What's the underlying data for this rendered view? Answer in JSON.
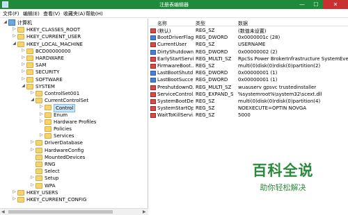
{
  "window": {
    "title": "注册表编辑器",
    "min": "—",
    "max": "☐",
    "close": "✕"
  },
  "menu": [
    "文件(F)",
    "编辑(E)",
    "查看(V)",
    "收藏夹(A)",
    "帮助(H)"
  ],
  "tree": [
    {
      "label": "计算机",
      "arrow": "◢",
      "icon": "pc"
    },
    {
      "label": "HKEY_CLASSES_ROOT",
      "arrow": "▷"
    },
    {
      "label": "HKEY_CURRENT_USER",
      "arrow": "▷"
    },
    {
      "label": "HKEY_LOCAL_MACHINE",
      "arrow": "◢"
    },
    {
      "label": "BCD00000000",
      "arrow": "▷"
    },
    {
      "label": "HARDWARE",
      "arrow": "▷"
    },
    {
      "label": "SAM",
      "arrow": "▷"
    },
    {
      "label": "SECURITY",
      "arrow": "▷"
    },
    {
      "label": "SOFTWARE",
      "arrow": "▷"
    },
    {
      "label": "SYSTEM",
      "arrow": "◢"
    },
    {
      "label": "ControlSet001",
      "arrow": "▷"
    },
    {
      "label": "CurrentControlSet",
      "arrow": "◢"
    },
    {
      "label": "Control",
      "arrow": "▷",
      "selected": true
    },
    {
      "label": "Enum",
      "arrow": "▷"
    },
    {
      "label": "Hardware Profiles",
      "arrow": "▷"
    },
    {
      "label": "Policies",
      "arrow": ""
    },
    {
      "label": "Services",
      "arrow": "▷"
    },
    {
      "label": "DriverDatabase",
      "arrow": "▷"
    },
    {
      "label": "HardwareConfig",
      "arrow": "▷"
    },
    {
      "label": "MountedDevices",
      "arrow": ""
    },
    {
      "label": "RNG",
      "arrow": ""
    },
    {
      "label": "Select",
      "arrow": ""
    },
    {
      "label": "Setup",
      "arrow": "▷"
    },
    {
      "label": "WPA",
      "arrow": "▷"
    },
    {
      "label": "HKEY_USERS",
      "arrow": "▷"
    },
    {
      "label": "HKEY_CURRENT_CONFIG",
      "arrow": "▷"
    }
  ],
  "columns": {
    "name": "名称",
    "type": "类型",
    "data": "数据"
  },
  "rows": [
    {
      "name": "(默认)",
      "type": "REG_SZ",
      "data": "(数值未设置)",
      "kind": "str"
    },
    {
      "name": "BootDriverFlags",
      "type": "REG_DWORD",
      "data": "0x0000001c (28)",
      "kind": "bin"
    },
    {
      "name": "CurrentUser",
      "type": "REG_SZ",
      "data": "USERNAME",
      "kind": "str"
    },
    {
      "name": "DirtyShutdown...",
      "type": "REG_DWORD",
      "data": "0x00000002 (2)",
      "kind": "bin"
    },
    {
      "name": "EarlyStartServi...",
      "type": "REG_MULTI_SZ",
      "data": "RpcSs Power BrokerInfrastructure SystemEve...",
      "kind": "str"
    },
    {
      "name": "FirmwareBoot...",
      "type": "REG_SZ",
      "data": "multi(0)disk(0)rdisk(0)partition(2)",
      "kind": "str"
    },
    {
      "name": "LastBootShutd...",
      "type": "REG_DWORD",
      "data": "0x00000001 (1)",
      "kind": "bin"
    },
    {
      "name": "LastBootSucce...",
      "type": "REG_DWORD",
      "data": "0x00000001 (1)",
      "kind": "bin"
    },
    {
      "name": "PreshutdownO...",
      "type": "REG_MULTI_SZ",
      "data": "wuauserv gpsvc trustedinstaller",
      "kind": "str"
    },
    {
      "name": "ServiceControl...",
      "type": "REG_EXPAND_SZ",
      "data": "%systemroot%\\system32\\scext.dll",
      "kind": "str"
    },
    {
      "name": "SystemBootDe...",
      "type": "REG_SZ",
      "data": "multi(0)disk(0)rdisk(0)partition(4)",
      "kind": "str"
    },
    {
      "name": "SystemStartOp...",
      "type": "REG_SZ",
      "data": " NOEXECUTE=OPTIN  NOVGA",
      "kind": "str"
    },
    {
      "name": "WaitToKillServi...",
      "type": "REG_SZ",
      "data": "5000",
      "kind": "str"
    }
  ],
  "watermark": {
    "title": "百科全说",
    "subtitle": "助你轻松解决"
  },
  "colors": {
    "titlebar": "#1f8b3a",
    "selection": "#cce4f7",
    "folder": "#f5d46e",
    "watermark": "#2a8a3a"
  }
}
